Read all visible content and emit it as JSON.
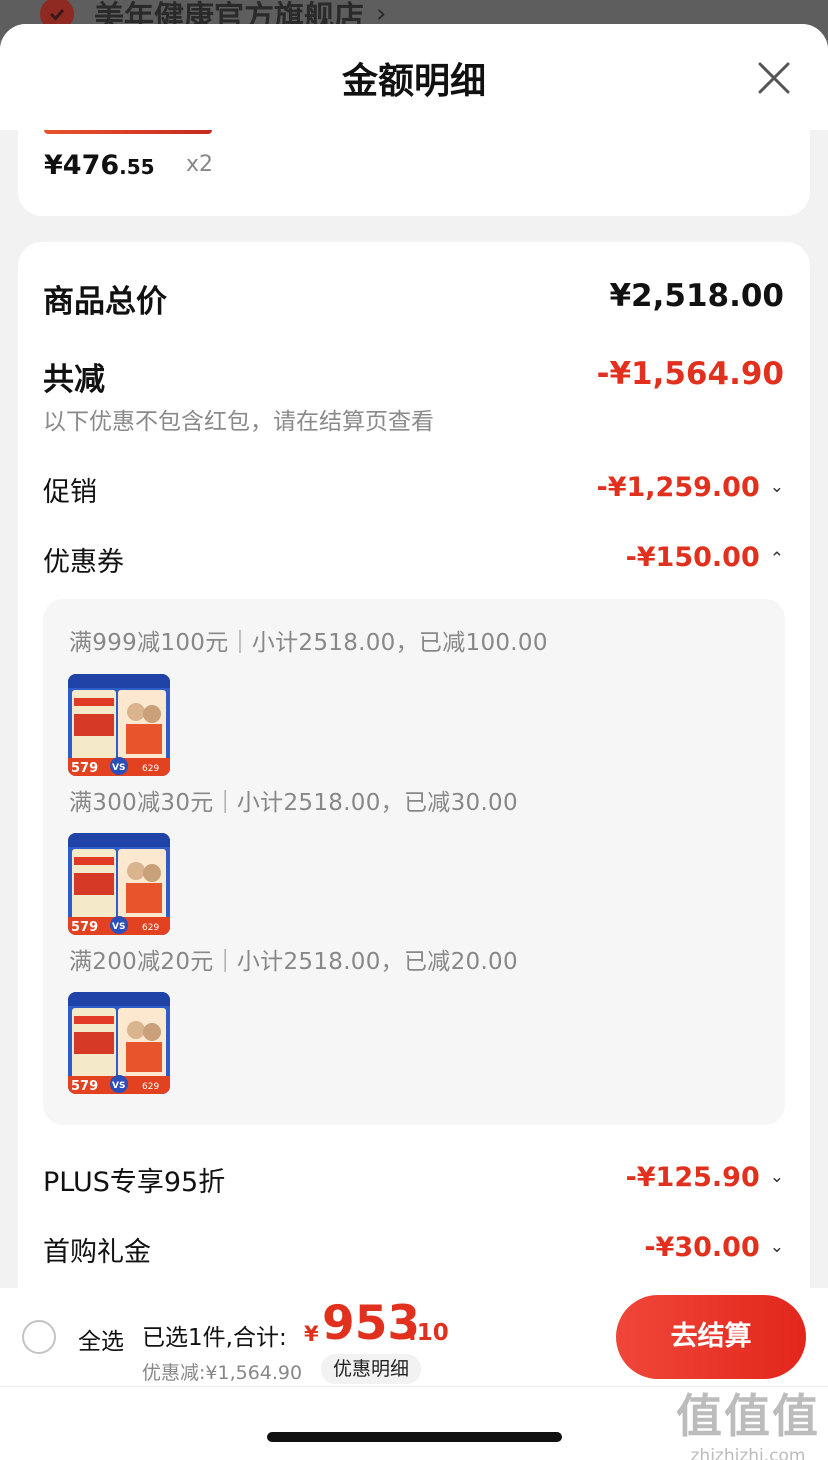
{
  "background_store": {
    "name": "美年健康官方旗舰店",
    "chevron": "›"
  },
  "sheet": {
    "title": "金额明细",
    "close_icon": "close-icon"
  },
  "product": {
    "price_main": "¥476",
    "price_decimal": ".55",
    "quantity": "x2"
  },
  "summary": {
    "total_label": "商品总价",
    "total_value": "¥2,518.00",
    "reduced_label": "共减",
    "reduced_value": "-¥1,564.90",
    "note": "以下优惠不包含红包，请在结算页查看",
    "promo_label": "促销",
    "promo_value": "-¥1,259.00",
    "coupon_label": "优惠券",
    "coupon_value": "-¥150.00",
    "plus_label": "PLUS专享95折",
    "plus_value": "-¥125.90",
    "first_buy_label": "首购礼金",
    "first_buy_value": "-¥30.00"
  },
  "coupons": [
    {
      "rule": "满999减100元｜小计2518.00，已减100.00"
    },
    {
      "rule": "满300减30元｜小计2518.00，已减30.00"
    },
    {
      "rule": "满200减20元｜小计2518.00，已减20.00"
    }
  ],
  "thumb": {
    "price_left": "579",
    "vs": "VS",
    "price_right": "629"
  },
  "bottom_bar": {
    "select_all": "全选",
    "selected_total": "已选1件,合计:",
    "total_yen": "¥",
    "total_int": "953",
    "total_dec": ".10",
    "discount": "优惠减:¥1,564.90",
    "discount_detail": "优惠明细",
    "checkout": "去结算"
  },
  "watermark": {
    "logo": "值值值",
    "site": "zhizhizhi.com"
  },
  "colors": {
    "accent_red": "#e1301d",
    "sheet_bg": "#f2f2f2"
  }
}
